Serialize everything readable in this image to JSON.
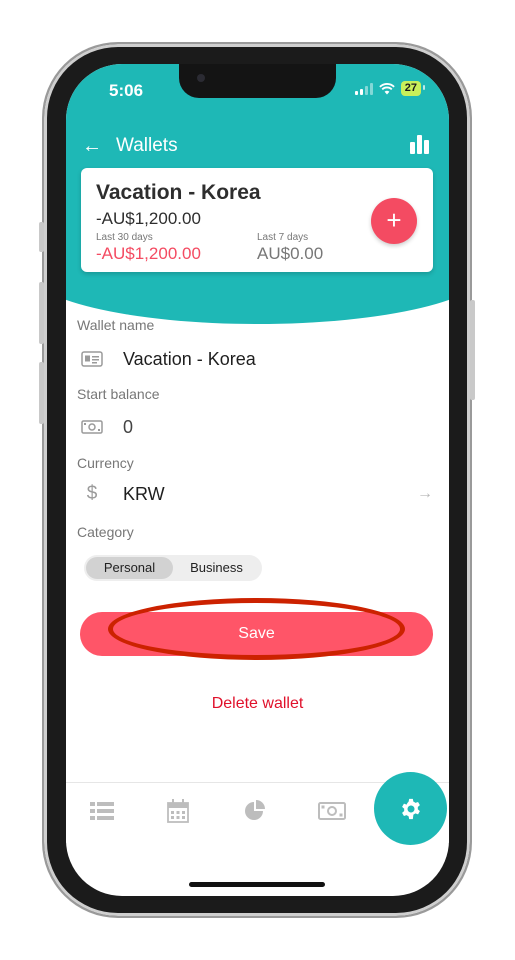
{
  "status_bar": {
    "time": "5:06",
    "battery": "27"
  },
  "app_bar": {
    "title": "Wallets",
    "back_icon": "arrow-left-icon",
    "stats_icon": "bar-chart-icon"
  },
  "summary_card": {
    "wallet_title": "Vacation - Korea",
    "balance": "-AU$1,200.00",
    "last_30_label": "Last 30 days",
    "last_30_value": "-AU$1,200.00",
    "last_7_label": "Last 7 days",
    "last_7_value": "AU$0.00",
    "add_label": "+"
  },
  "form": {
    "wallet_name_label": "Wallet name",
    "wallet_name_value": "Vacation - Korea",
    "start_balance_label": "Start balance",
    "start_balance_value": "0",
    "currency_label": "Currency",
    "currency_symbol": "$",
    "currency_value": "KRW",
    "currency_arrow": "→",
    "category_label": "Category",
    "category_options": [
      "Personal",
      "Business"
    ],
    "category_selected": "Personal"
  },
  "actions": {
    "save_label": "Save",
    "delete_label": "Delete wallet"
  },
  "bottom_nav": {
    "items": [
      "list-icon",
      "calendar-icon",
      "pie-chart-icon",
      "cash-icon",
      "gear-icon"
    ],
    "active": "gear-icon"
  },
  "colors": {
    "teal": "#1eb8b6",
    "accent_red": "#ff5568",
    "negative_red": "#f44b62",
    "delete_red": "#e0112b",
    "annotation_red": "#cc2200"
  }
}
